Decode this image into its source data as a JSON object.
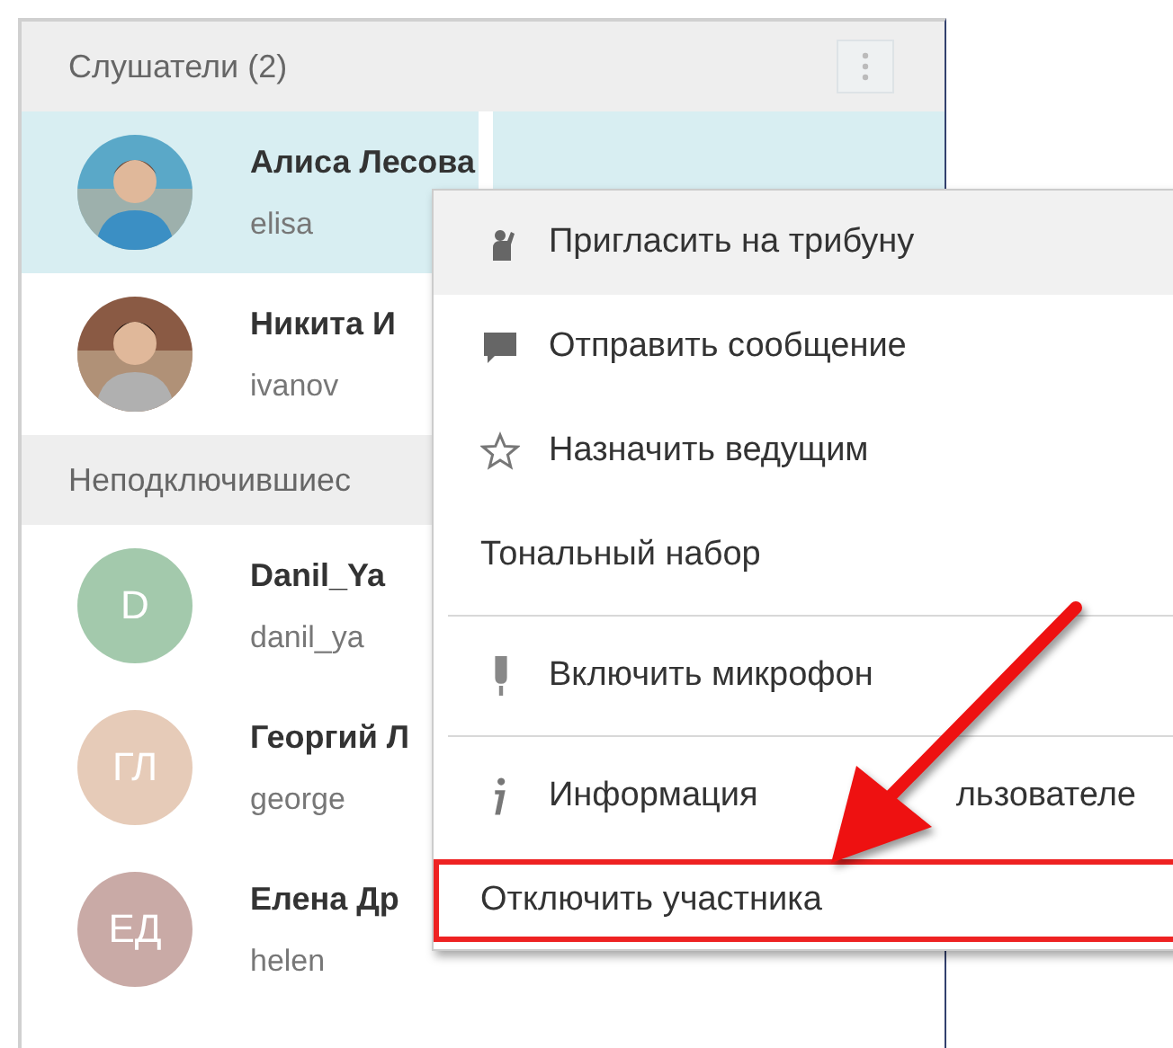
{
  "sections": [
    {
      "title": "Слушатели (2)",
      "has_menu_button": true,
      "members": [
        {
          "name": "Алиса Лесова",
          "login": "elisa",
          "selected": true
        },
        {
          "name": "Никита И",
          "login": "ivanov",
          "selected": false
        }
      ]
    },
    {
      "title": "Неподключившиес",
      "has_menu_button": false,
      "members": [
        {
          "name": "Danil_Ya",
          "login": "danil_ya",
          "selected": false,
          "avatar": {
            "kind": "initials",
            "initials": "D",
            "color": "#a3c9ac"
          }
        },
        {
          "name": "Георгий Л",
          "login": "george",
          "selected": false,
          "avatar": {
            "kind": "initials",
            "initials": "ГЛ",
            "color": "#e6cbb8"
          }
        },
        {
          "name": "Елена Др",
          "login": "helen",
          "selected": false,
          "avatar": {
            "kind": "initials",
            "initials": "ЕД",
            "color": "#c9aaa6"
          }
        }
      ]
    }
  ],
  "context_menu": [
    {
      "label": "Пригласить на трибуну",
      "highlighted": true,
      "divider_before": false,
      "outlined": false
    },
    {
      "label": "Отправить сообщение",
      "highlighted": false,
      "divider_before": false,
      "outlined": false
    },
    {
      "label": "Назначить ведущим",
      "highlighted": false,
      "divider_before": false,
      "outlined": false
    },
    {
      "label": "Тональный набор",
      "highlighted": false,
      "divider_before": false,
      "outlined": false
    },
    {
      "label": "Включить микрофон",
      "highlighted": false,
      "divider_before": true,
      "outlined": false
    },
    {
      "label": "Информация",
      "label_continued": "льзователе",
      "highlighted": false,
      "divider_before": true,
      "outlined": false
    },
    {
      "label": "Отключить участника",
      "highlighted": false,
      "divider_before": false,
      "outlined": true
    }
  ]
}
